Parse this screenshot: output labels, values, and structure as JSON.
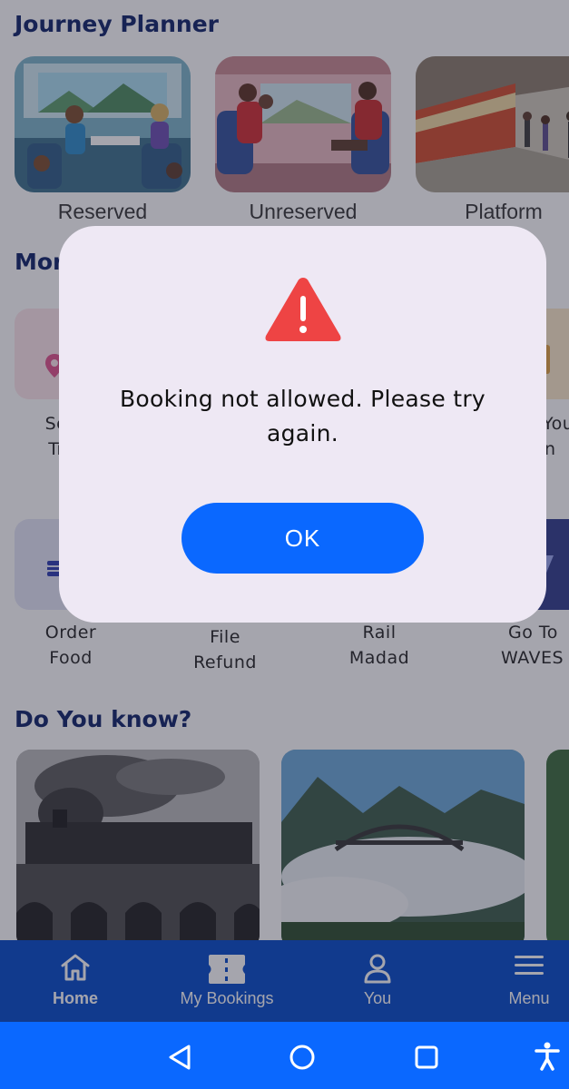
{
  "sections": {
    "journey_planner": "Journey Planner",
    "more_services_partial": "Mor",
    "do_you_know": "Do You know?"
  },
  "journey_cards": [
    {
      "label": "Reserved"
    },
    {
      "label": "Unreserved"
    },
    {
      "label": "Platform"
    }
  ],
  "services_row1": [
    {
      "label_line1": "Se",
      "label_line2": "Tr",
      "icon": "map-pin-icon"
    },
    {
      "label_line1": "You",
      "label_line2": "n",
      "icon": "ticket-icon"
    }
  ],
  "services_row2": [
    {
      "label": "Order\nFood",
      "icon": "food-icon"
    },
    {
      "label": "File\nRefund",
      "icon": "refund-icon"
    },
    {
      "label": "Rail\nMadad",
      "icon": "help-icon"
    },
    {
      "label": "Go To\nWAVES",
      "icon": "waves-icon"
    }
  ],
  "bottom_nav": {
    "items": [
      {
        "label": "Home",
        "icon": "home-icon",
        "active": true
      },
      {
        "label": "My Bookings",
        "icon": "ticket-icon",
        "active": false
      },
      {
        "label": "You",
        "icon": "user-icon",
        "active": false
      },
      {
        "label": "Menu",
        "icon": "menu-icon",
        "active": false
      }
    ]
  },
  "system_nav": {
    "back": "back-icon",
    "home": "home-circle-icon",
    "recents": "recents-icon",
    "accessibility": "accessibility-icon"
  },
  "dialog": {
    "icon": "warning-icon",
    "message": "Booking not allowed. Please try again.",
    "ok_label": "OK"
  },
  "colors": {
    "primary": "#0a68ff",
    "nav_bg": "#0047c9",
    "title": "#0b1f66",
    "warning": "#ee4444",
    "dialog_bg": "#eee8f4"
  }
}
